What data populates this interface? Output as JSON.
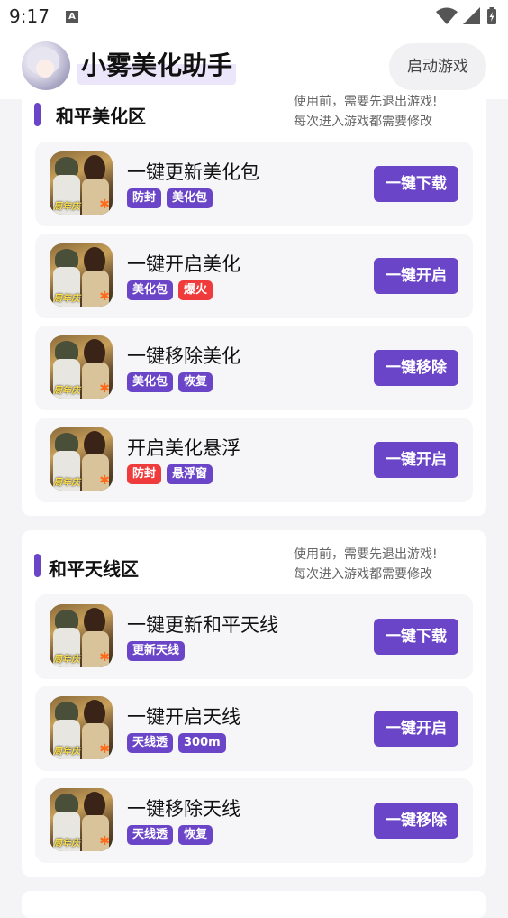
{
  "status_bar": {
    "time": "9:17",
    "left_icon": "A-notification-icon",
    "right_icons": [
      "wifi-icon",
      "signal-icon",
      "battery-charging-icon"
    ]
  },
  "header": {
    "title": "小雾美化助手",
    "launch_button": "启动游戏",
    "avatar_icon": "anime-avatar"
  },
  "colors": {
    "accent": "#6b45c8",
    "danger_tag": "#ef3b3b",
    "card_bg": "#f6f6f8",
    "page_bg": "#f4f4f6"
  },
  "sections": [
    {
      "title": "和平美化区",
      "note_line1": "使用前，需要先退出游戏!",
      "note_line2": "每次进入游戏都需要修改",
      "cards": [
        {
          "title": "一键更新美化包",
          "tags": [
            {
              "text": "防封",
              "color": "purple"
            },
            {
              "text": "美化包",
              "color": "purple"
            }
          ],
          "button": "一键下载"
        },
        {
          "title": "一键开启美化",
          "tags": [
            {
              "text": "美化包",
              "color": "purple"
            },
            {
              "text": "爆火",
              "color": "red"
            }
          ],
          "button": "一键开启"
        },
        {
          "title": "一键移除美化",
          "tags": [
            {
              "text": "美化包",
              "color": "purple"
            },
            {
              "text": "恢复",
              "color": "purple"
            }
          ],
          "button": "一键移除"
        },
        {
          "title": "开启美化悬浮",
          "tags": [
            {
              "text": "防封",
              "color": "red"
            },
            {
              "text": "悬浮窗",
              "color": "purple"
            }
          ],
          "button": "一键开启"
        }
      ]
    },
    {
      "title": "和平天线区",
      "note_line1": "使用前，需要先退出游戏!",
      "note_line2": "每次进入游戏都需要修改",
      "cards": [
        {
          "title": "一键更新和平天线",
          "tags": [
            {
              "text": "更新天线",
              "color": "purple"
            }
          ],
          "button": "一键下载"
        },
        {
          "title": "一键开启天线",
          "tags": [
            {
              "text": "天线透",
              "color": "purple"
            },
            {
              "text": "300m",
              "color": "purple"
            }
          ],
          "button": "一键开启"
        },
        {
          "title": "一键移除天线",
          "tags": [
            {
              "text": "天线透",
              "color": "purple"
            },
            {
              "text": "恢复",
              "color": "purple"
            }
          ],
          "button": "一键移除"
        }
      ]
    }
  ],
  "game_icon_badge": "周年庆"
}
